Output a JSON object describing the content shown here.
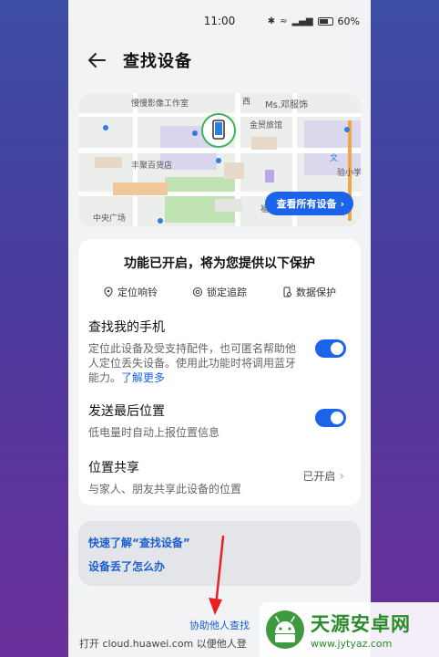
{
  "status_bar": {
    "time": "11:00",
    "battery": "60%"
  },
  "header": {
    "title": "查找设备"
  },
  "map": {
    "labels": [
      "慢慢影像工作室",
      "西",
      "Ms.邓服饰",
      "金贸旅馆",
      "丰聚百货店",
      "文",
      "验小学",
      "中央广场",
      "福"
    ],
    "view_all_button": "查看所有设备"
  },
  "protection": {
    "title": "功能已开启，将为您提供以下保护",
    "features": [
      "定位响铃",
      "锁定追踪",
      "数据保护"
    ]
  },
  "settings": {
    "find_phone": {
      "title": "查找我的手机",
      "desc": "定位此设备及受支持配件，也可匿名帮助他人定位丢失设备。使用此功能时将调用蓝牙能力。",
      "learn_more": "了解更多"
    },
    "last_location": {
      "title": "发送最后位置",
      "desc": "低电量时自动上报位置信息"
    },
    "location_share": {
      "title": "位置共享",
      "desc": "与家人、朋友共享此设备的位置",
      "status": "已开启"
    }
  },
  "help": {
    "link1": "快速了解“查找设备”",
    "link2": "设备丢了怎么办"
  },
  "footer": {
    "assist_link": "协助他人查找",
    "text": "打开 cloud.huawei.com 以便他人登"
  },
  "watermark": {
    "title": "天源安卓网",
    "url": "www.jytyaz.com"
  },
  "colors": {
    "accent": "#1b63e8",
    "background_top": "#3d4ea6",
    "background_bottom": "#6b2f9a",
    "annotation": "#e8201f"
  }
}
